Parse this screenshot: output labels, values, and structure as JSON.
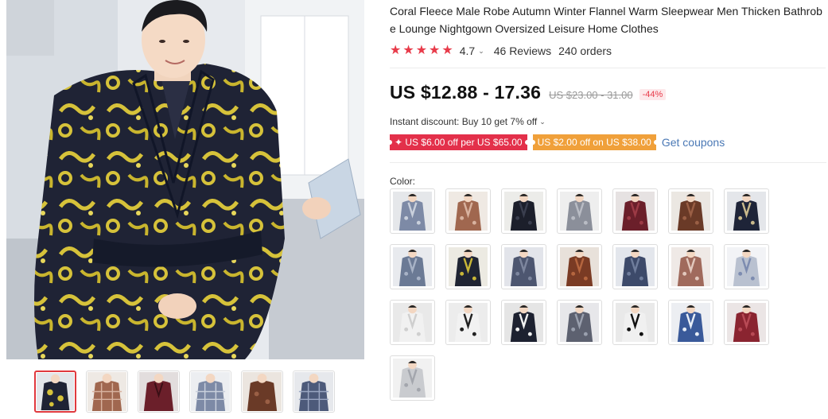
{
  "product": {
    "title": "Coral Fleece Male Robe Autumn Winter Flannel Warm Sleepwear Men Thicken Bathrobe Lounge Nightgown Oversized Leisure Home Clothes",
    "rating": "4.7",
    "reviews": "46 Reviews",
    "orders": "240 orders",
    "price": "US $12.88 - 17.36",
    "original_price": "US $23.00 - 31.00",
    "discount_pct": "-44%",
    "instant_discount": "Instant discount: Buy 10 get 7% off",
    "coupons": [
      {
        "label": "✦ US $6.00 off per US $65.00",
        "color": "#e3304a"
      },
      {
        "label": "US $2.00 off on US $38.00",
        "color": "#f0a03a"
      }
    ],
    "get_coupons": "Get coupons",
    "color_label": "Color:"
  },
  "accent_color": "#e83b4a",
  "link_color": "#4a78b5",
  "gallery": {
    "main_image": "man-in-dragon-print-robe",
    "thumbnails": [
      "dragon-print",
      "brown-plaid",
      "wine-red",
      "grey-plaid",
      "brown-print",
      "blue-plaid"
    ]
  },
  "swatches": [
    {
      "name": "blue-plaid",
      "robe": "#7d8aa6",
      "accent": "#c9d0dc",
      "bg": "#e5e7ea"
    },
    {
      "name": "brown-plaid",
      "robe": "#a0674f",
      "accent": "#d8b29f",
      "bg": "#efe9e3"
    },
    {
      "name": "black",
      "robe": "#1c1f2b",
      "accent": "#3a3e4e",
      "bg": "#ecece9"
    },
    {
      "name": "grey",
      "robe": "#8b8f9a",
      "accent": "#b9bcc4",
      "bg": "#eeeeee"
    },
    {
      "name": "wine-red",
      "robe": "#6b1f2a",
      "accent": "#9c3a45",
      "bg": "#e6e2e2"
    },
    {
      "name": "brown",
      "robe": "#6a3a27",
      "accent": "#9a5f45",
      "bg": "#ebe7e2"
    },
    {
      "name": "navy",
      "robe": "#1e2438",
      "accent": "#c9b98c",
      "bg": "#e4e6ea"
    },
    {
      "name": "grey-blue",
      "robe": "#6b7a95",
      "accent": "#a7b2c6",
      "bg": "#e8eaee"
    },
    {
      "name": "dragon",
      "robe": "#1f2433",
      "accent": "#c8b637",
      "bg": "#eceae2"
    },
    {
      "name": "slate",
      "robe": "#4d5670",
      "accent": "#7d869e",
      "bg": "#e2e4ea"
    },
    {
      "name": "copper",
      "robe": "#7a3b24",
      "accent": "#b5663f",
      "bg": "#e8e1da"
    },
    {
      "name": "dark-blue",
      "robe": "#3d4a6a",
      "accent": "#6f7d9c",
      "bg": "#e3e6ec"
    },
    {
      "name": "rose-print",
      "robe": "#a06a5c",
      "accent": "#e2c8bd",
      "bg": "#efe9e6"
    },
    {
      "name": "check",
      "robe": "#b9c1d0",
      "accent": "#7d8cb0",
      "bg": "#f2f3f6"
    },
    {
      "name": "white",
      "robe": "#f1f1f1",
      "accent": "#cfcfcf",
      "bg": "#e9e9e9"
    },
    {
      "name": "panda",
      "robe": "#f2f2f2",
      "accent": "#222222",
      "bg": "#ececec"
    },
    {
      "name": "star-print",
      "robe": "#1d2130",
      "accent": "#f0f0f0",
      "bg": "#e5e5e5"
    },
    {
      "name": "grey-print",
      "robe": "#5d6170",
      "accent": "#9aa0ae",
      "bg": "#e7e7ea"
    },
    {
      "name": "cow",
      "robe": "#f0f0f0",
      "accent": "#111111",
      "bg": "#e9e9e9"
    },
    {
      "name": "blue-white",
      "robe": "#3a5a9a",
      "accent": "#e8eef7",
      "bg": "#eceef2"
    },
    {
      "name": "burgundy",
      "robe": "#8a2430",
      "accent": "#b84a55",
      "bg": "#ebe5e5"
    },
    {
      "name": "light-grey",
      "robe": "#c9cbcf",
      "accent": "#a3a6ad",
      "bg": "#f1f1f1"
    }
  ]
}
